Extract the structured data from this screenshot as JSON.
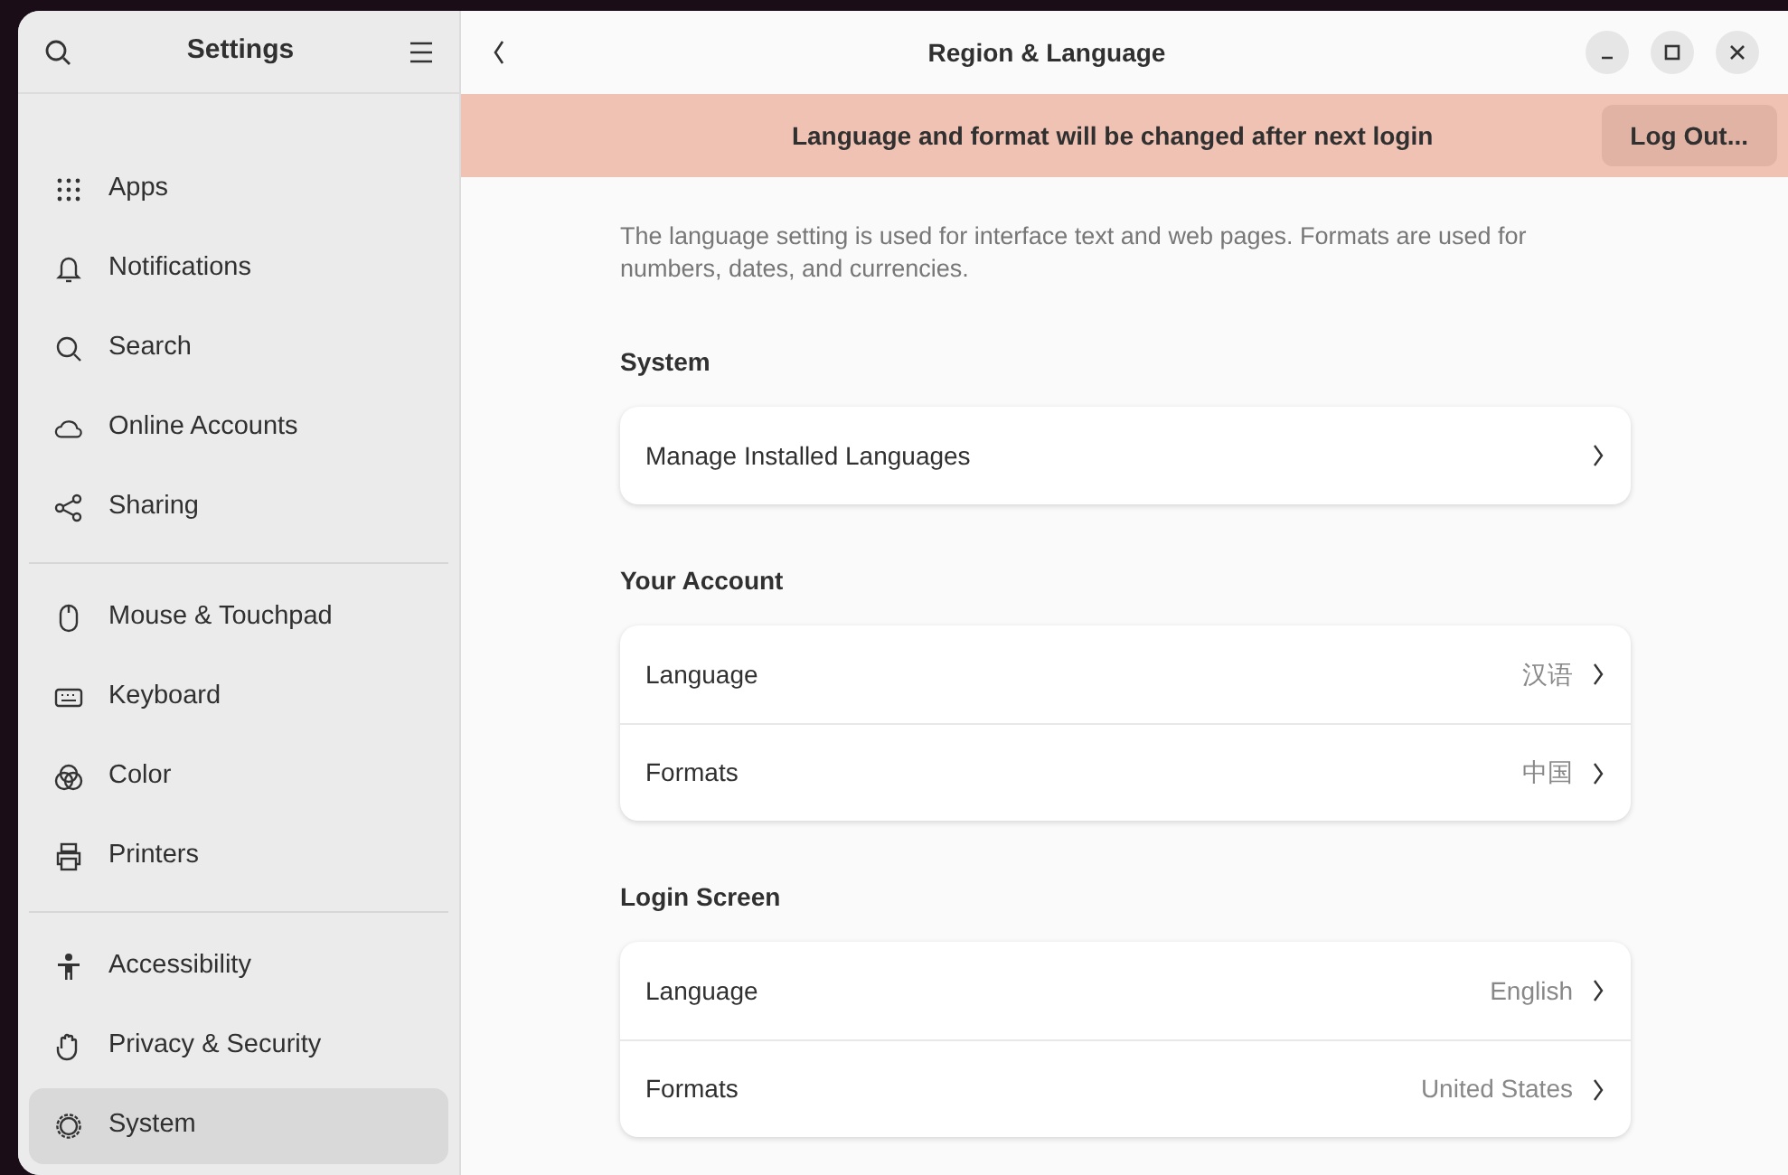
{
  "sidebar": {
    "title": "Settings",
    "groups": [
      {
        "items": [
          {
            "label": "Apps",
            "selected": false
          },
          {
            "label": "Notifications",
            "selected": false
          },
          {
            "label": "Search",
            "selected": false
          },
          {
            "label": "Online Accounts",
            "selected": false
          },
          {
            "label": "Sharing",
            "selected": false
          }
        ]
      },
      {
        "items": [
          {
            "label": "Mouse & Touchpad",
            "selected": false
          },
          {
            "label": "Keyboard",
            "selected": false
          },
          {
            "label": "Color",
            "selected": false
          },
          {
            "label": "Printers",
            "selected": false
          }
        ]
      },
      {
        "items": [
          {
            "label": "Accessibility",
            "selected": false
          },
          {
            "label": "Privacy & Security",
            "selected": false
          },
          {
            "label": "System",
            "selected": true
          }
        ]
      }
    ]
  },
  "window": {
    "title": "Region & Language"
  },
  "banner": {
    "message": "Language and format will be changed after next login",
    "button": "Log Out..."
  },
  "description": "The language setting is used for interface text and web pages. Formats are used for numbers, dates, and currencies.",
  "sections": [
    {
      "title": "System",
      "rows": [
        {
          "label": "Manage Installed Languages"
        }
      ]
    },
    {
      "title": "Your Account",
      "rows": [
        {
          "label": "Language",
          "value": "汉语"
        },
        {
          "label": "Formats",
          "value": "中国"
        }
      ]
    },
    {
      "title": "Login Screen",
      "rows": [
        {
          "label": "Language",
          "value": "English"
        },
        {
          "label": "Formats",
          "value": "United States"
        }
      ]
    }
  ]
}
